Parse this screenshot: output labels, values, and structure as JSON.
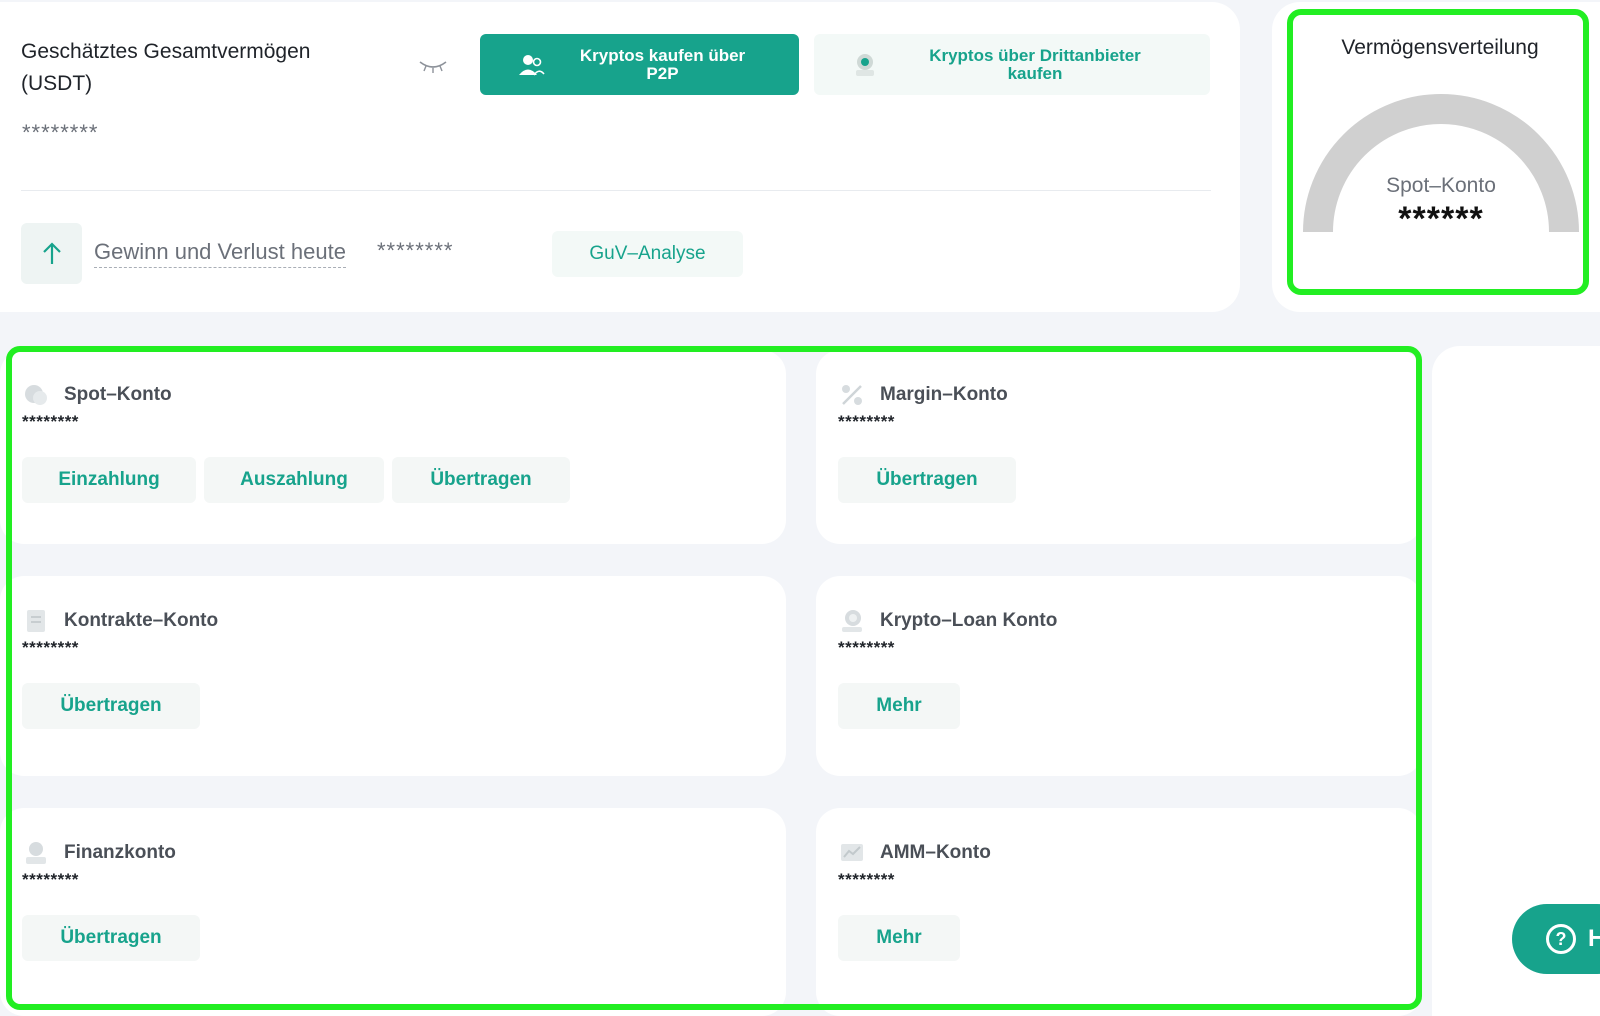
{
  "overview": {
    "title_line1": "Geschätztes Gesamtvermögen",
    "title_line2": "(USDT)",
    "total_value_masked": "********",
    "buy_p2p_line1": "Kryptos kaufen über",
    "buy_p2p_line2": "P2P",
    "buy_thirdparty_line1": "Kryptos über Drittanbieter",
    "buy_thirdparty_line2": "kaufen",
    "pnl_label": "Gewinn und Verlust heute",
    "pnl_value_masked": "********",
    "pnl_analysis_label": "GuV–Analyse"
  },
  "distribution": {
    "title": "Vermögensverteilung",
    "gauge_label": "Spot–Konto",
    "gauge_value_masked": "******"
  },
  "accounts": [
    {
      "name": "Spot–Konto",
      "value": "********",
      "actions": [
        "Einzahlung",
        "Auszahlung",
        "Übertragen"
      ],
      "icon": "coins-icon"
    },
    {
      "name": "Margin–Konto",
      "value": "********",
      "actions": [
        "Übertragen"
      ],
      "icon": "percent-icon"
    },
    {
      "name": "Kontrakte–Konto",
      "value": "********",
      "actions": [
        "Übertragen"
      ],
      "icon": "document-icon"
    },
    {
      "name": "Krypto–Loan Konto",
      "value": "********",
      "actions": [
        "Mehr"
      ],
      "icon": "loan-icon"
    },
    {
      "name": "Finanzkonto",
      "value": "********",
      "actions": [
        "Übertragen"
      ],
      "icon": "finance-icon"
    },
    {
      "name": "AMM–Konto",
      "value": "********",
      "actions": [
        "Mehr"
      ],
      "icon": "chart-icon"
    }
  ],
  "help": {
    "label": "H"
  },
  "colors": {
    "accent": "#17a38c",
    "highlight": "#22ee22",
    "muted": "#6b7079"
  }
}
